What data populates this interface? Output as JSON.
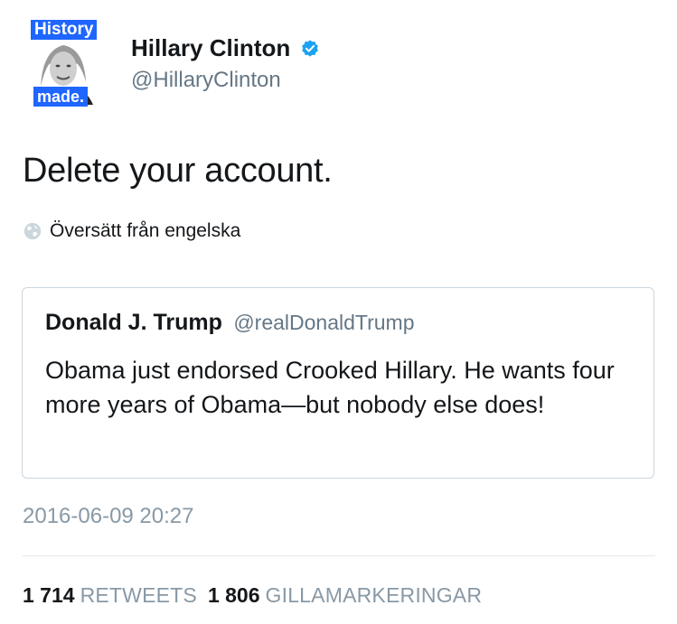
{
  "author": {
    "avatar_badge_top": "History",
    "avatar_badge_bottom": "made.",
    "display_name": "Hillary Clinton",
    "handle": "@HillaryClinton",
    "verified_icon": "verified-badge-icon"
  },
  "tweet": {
    "text": "Delete your account.",
    "translate_label": "Översätt från engelska",
    "translate_icon": "globe-icon"
  },
  "quoted_tweet": {
    "display_name": "Donald J. Trump",
    "handle": "@realDonaldTrump",
    "text": "Obama just endorsed Crooked Hillary. He wants four more years of Obama—but nobody else does!"
  },
  "timestamp": "2016-06-09 20:27",
  "stats": {
    "retweets_count": "1 714",
    "retweets_label": "RETWEETS",
    "likes_count": "1 806",
    "likes_label": "GILLAMARKERINGAR"
  },
  "colors": {
    "badge_blue": "#1e66ff",
    "verified_blue": "#1da1f2",
    "secondary_text": "#657786",
    "muted_text": "#8899a6"
  }
}
